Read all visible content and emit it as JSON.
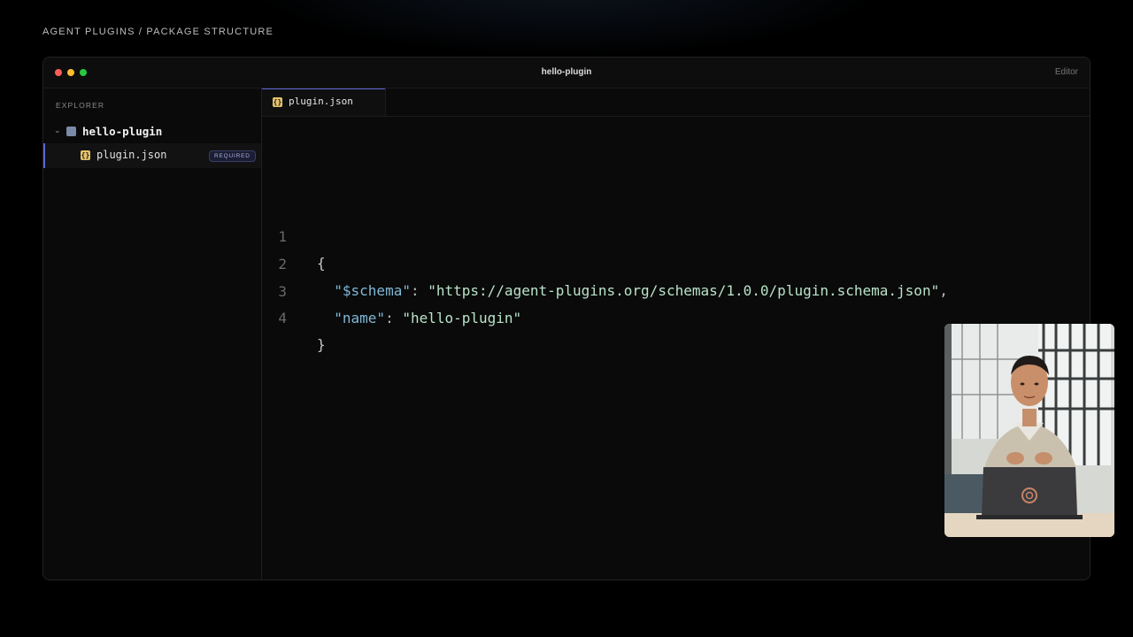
{
  "breadcrumb": "AGENT PLUGINS / PACKAGE STRUCTURE",
  "window": {
    "title": "hello-plugin",
    "mode_label": "Editor"
  },
  "sidebar": {
    "section_label": "EXPLORER",
    "folder": {
      "name": "hello-plugin",
      "expanded": true,
      "icon": "folder-icon"
    },
    "files": [
      {
        "name": "plugin.json",
        "icon": "json-file-icon",
        "badge": "REQUIRED",
        "selected": true
      }
    ]
  },
  "tabs": [
    {
      "label": "plugin.json",
      "icon": "json-file-icon",
      "active": true
    }
  ],
  "editor": {
    "lines": [
      {
        "number": "1",
        "tokens": [
          {
            "t": "{",
            "k": "brace"
          }
        ]
      },
      {
        "number": "2",
        "tokens": [
          {
            "t": "  ",
            "k": "punc"
          },
          {
            "t": "\"$schema\"",
            "k": "key"
          },
          {
            "t": ": ",
            "k": "punc"
          },
          {
            "t": "\"https://agent-plugins.org/schemas/1.0.0/plugin.schema.json\"",
            "k": "str"
          },
          {
            "t": ",",
            "k": "punc"
          }
        ]
      },
      {
        "number": "3",
        "tokens": [
          {
            "t": "  ",
            "k": "punc"
          },
          {
            "t": "\"name\"",
            "k": "key"
          },
          {
            "t": ": ",
            "k": "punc"
          },
          {
            "t": "\"hello-plugin\"",
            "k": "str"
          }
        ]
      },
      {
        "number": "4",
        "tokens": [
          {
            "t": "}",
            "k": "brace"
          }
        ]
      }
    ]
  },
  "colors": {
    "accent": "#5b67d8",
    "json_icon": "#e6c36a",
    "key": "#7fb8d6",
    "string": "#b9e3c9",
    "traffic_red": "#ff5f57",
    "traffic_yellow": "#febc2e",
    "traffic_green": "#28c840"
  },
  "presenter_video": {
    "icon": "presenter-video-thumbnail"
  }
}
